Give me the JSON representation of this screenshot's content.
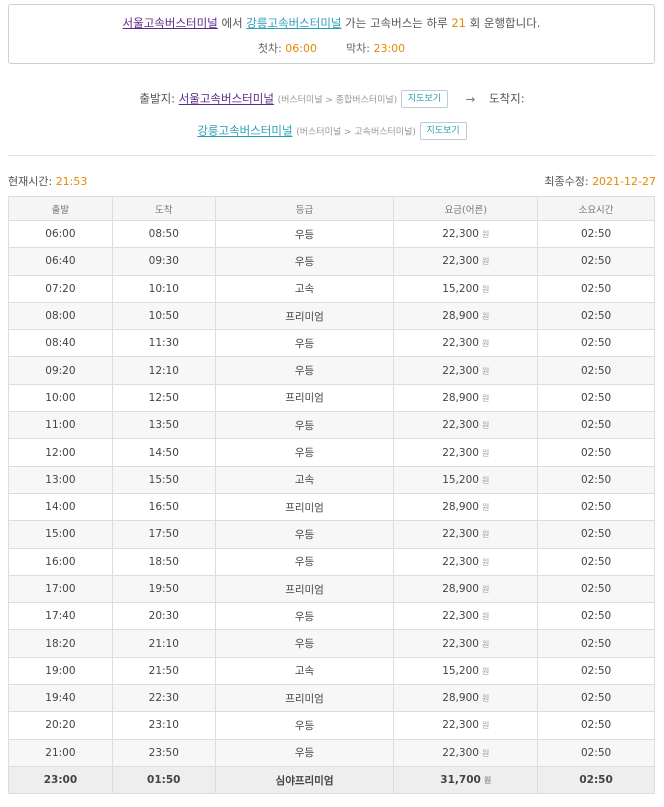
{
  "summary": {
    "origin": "서울고속버스터미널",
    "from_text": "에서",
    "destination": "강릉고속버스터미널",
    "middle_text": "가는 고속버스는 하루",
    "count": "21",
    "end_text": "회 운행합니다.",
    "first_label": "첫차:",
    "first_time": "06:00",
    "last_label": "막차:",
    "last_time": "23:00"
  },
  "route": {
    "depart_label": "출발지:",
    "depart_name": "서울고속버스터미널",
    "depart_path": "(버스터미널 > 종합버스터미널)",
    "map_button": "지도보기",
    "arrow": "→",
    "arrive_label": "도착지:",
    "arrive_name": "강릉고속버스터미널",
    "arrive_path": "(버스터미널 > 고속버스터미널)"
  },
  "info": {
    "current_label": "현재시간:",
    "current_time": "21:53",
    "updated_label": "최종수정:",
    "updated_date": "2021-12-27"
  },
  "table": {
    "headers": [
      "출발",
      "도착",
      "등급",
      "요금(어른)",
      "소요시간"
    ],
    "currency": "원",
    "rows": [
      {
        "dep": "06:00",
        "arr": "08:50",
        "grade": "우등",
        "fare": "22,300",
        "dur": "02:50"
      },
      {
        "dep": "06:40",
        "arr": "09:30",
        "grade": "우등",
        "fare": "22,300",
        "dur": "02:50"
      },
      {
        "dep": "07:20",
        "arr": "10:10",
        "grade": "고속",
        "fare": "15,200",
        "dur": "02:50"
      },
      {
        "dep": "08:00",
        "arr": "10:50",
        "grade": "프리미엄",
        "fare": "28,900",
        "dur": "02:50"
      },
      {
        "dep": "08:40",
        "arr": "11:30",
        "grade": "우등",
        "fare": "22,300",
        "dur": "02:50"
      },
      {
        "dep": "09:20",
        "arr": "12:10",
        "grade": "우등",
        "fare": "22,300",
        "dur": "02:50"
      },
      {
        "dep": "10:00",
        "arr": "12:50",
        "grade": "프리미엄",
        "fare": "28,900",
        "dur": "02:50"
      },
      {
        "dep": "11:00",
        "arr": "13:50",
        "grade": "우등",
        "fare": "22,300",
        "dur": "02:50"
      },
      {
        "dep": "12:00",
        "arr": "14:50",
        "grade": "우등",
        "fare": "22,300",
        "dur": "02:50"
      },
      {
        "dep": "13:00",
        "arr": "15:50",
        "grade": "고속",
        "fare": "15,200",
        "dur": "02:50"
      },
      {
        "dep": "14:00",
        "arr": "16:50",
        "grade": "프리미엄",
        "fare": "28,900",
        "dur": "02:50"
      },
      {
        "dep": "15:00",
        "arr": "17:50",
        "grade": "우등",
        "fare": "22,300",
        "dur": "02:50"
      },
      {
        "dep": "16:00",
        "arr": "18:50",
        "grade": "우등",
        "fare": "22,300",
        "dur": "02:50"
      },
      {
        "dep": "17:00",
        "arr": "19:50",
        "grade": "프리미엄",
        "fare": "28,900",
        "dur": "02:50"
      },
      {
        "dep": "17:40",
        "arr": "20:30",
        "grade": "우등",
        "fare": "22,300",
        "dur": "02:50"
      },
      {
        "dep": "18:20",
        "arr": "21:10",
        "grade": "우등",
        "fare": "22,300",
        "dur": "02:50"
      },
      {
        "dep": "19:00",
        "arr": "21:50",
        "grade": "고속",
        "fare": "15,200",
        "dur": "02:50"
      },
      {
        "dep": "19:40",
        "arr": "22:30",
        "grade": "프리미엄",
        "fare": "28,900",
        "dur": "02:50"
      },
      {
        "dep": "20:20",
        "arr": "23:10",
        "grade": "우등",
        "fare": "22,300",
        "dur": "02:50"
      },
      {
        "dep": "21:00",
        "arr": "23:50",
        "grade": "우등",
        "fare": "22,300",
        "dur": "02:50"
      },
      {
        "dep": "23:00",
        "arr": "01:50",
        "grade": "심야프리미엄",
        "fare": "31,700",
        "dur": "02:50"
      }
    ]
  },
  "colors": {
    "accent_orange": "#e58a00",
    "link_teal": "#2aa0b5",
    "link_visited": "#5b2a86"
  }
}
